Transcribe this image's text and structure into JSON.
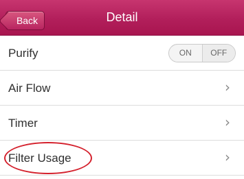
{
  "header": {
    "back_label": "Back",
    "title": "Detail"
  },
  "rows": [
    {
      "label": "Purify",
      "control": "toggle",
      "toggle": {
        "on": "ON",
        "off": "OFF"
      }
    },
    {
      "label": "Air Flow",
      "control": "chevron"
    },
    {
      "label": "Timer",
      "control": "chevron"
    },
    {
      "label": "Filter Usage",
      "control": "chevron"
    }
  ],
  "icons": {
    "chevron": "chevron-right-icon"
  },
  "colors": {
    "header": "#b21f5b",
    "highlight": "#d4202c"
  }
}
